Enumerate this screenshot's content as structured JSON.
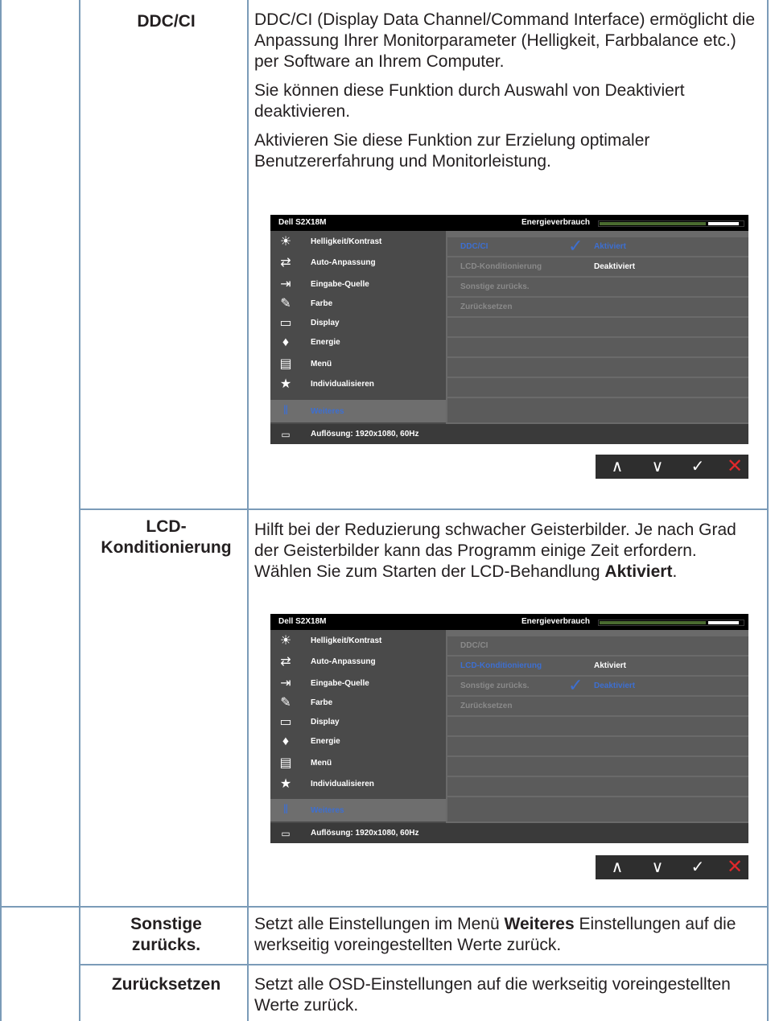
{
  "rows": [
    {
      "label": "DDC/CI",
      "paragraphs": [
        "DDC/CI (Display Data Channel/Command Interface) ermöglicht die Anpassung Ihrer Monitorparameter (Helligkeit, Farbbalance etc.) per Software an Ihrem Computer.",
        "Sie können diese Funktion durch Auswahl von Deaktiviert deaktivieren.",
        "Aktivieren Sie diese Funktion zur Erzielung optimaler Benutzererfahrung und Monitorleistung."
      ]
    },
    {
      "label": "LCD-Konditionierung",
      "label_line1": "LCD-",
      "label_line2": "Konditionierung",
      "text_plain": "Hilft bei der Reduzierung schwacher Geisterbilder. Je nach Grad der Geisterbilder kann das Programm einige Zeit erfordern. Wählen Sie zum Starten der LCD-Behandlung ",
      "text_bold": "Aktiviert",
      "text_end": "."
    },
    {
      "label_line1": "Sonstige",
      "label_line2": "zurücks.",
      "text_plain": "Setzt alle Einstellungen im Menü ",
      "text_bold": "Weiteres",
      "text_end": " Einstellungen auf die werkseitig voreingestellten Werte zurück."
    },
    {
      "label": "Zurücksetzen",
      "text": "Setzt alle OSD-Einstellungen auf die werkseitig voreingestellten Werte zurück."
    }
  ],
  "osd": {
    "model": "Dell S2X18M",
    "energy_label": "Energieverbrauch",
    "energy_level": 0.95,
    "menu_items": [
      {
        "label": "Helligkeit/Kontrast",
        "icon": "brightness-icon"
      },
      {
        "label": "Auto-Anpassung",
        "icon": "auto-adjust-icon"
      },
      {
        "label": "Eingabe-Quelle",
        "icon": "input-source-icon"
      },
      {
        "label": "Farbe",
        "icon": "color-icon"
      },
      {
        "label": "Display",
        "icon": "display-icon"
      },
      {
        "label": "Energie",
        "icon": "energy-icon"
      },
      {
        "label": "Menü",
        "icon": "menu-icon"
      },
      {
        "label": "Individualisieren",
        "icon": "star-icon"
      },
      {
        "label": "Weiteres",
        "icon": "others-icon"
      }
    ],
    "resolution": "Auflösung: 1920x1080, 60Hz",
    "sub_items": [
      "DDC/CI",
      "LCD-Konditionierung",
      "Sonstige zurücks.",
      "Zurücksetzen"
    ],
    "screen1": {
      "val1": "Aktiviert",
      "val2": "Deaktiviert"
    },
    "screen2": {
      "val1": "Aktiviert",
      "val2": "Deaktiviert"
    },
    "buttons": {
      "up": "∧",
      "down": "∨",
      "ok": "✓",
      "close": "✕"
    }
  },
  "colors": {
    "table_line": "#7b9bb8",
    "osd_highlight": "#3d6fd1",
    "energy_fill": "#4a6b30",
    "close": "#e0282a"
  }
}
